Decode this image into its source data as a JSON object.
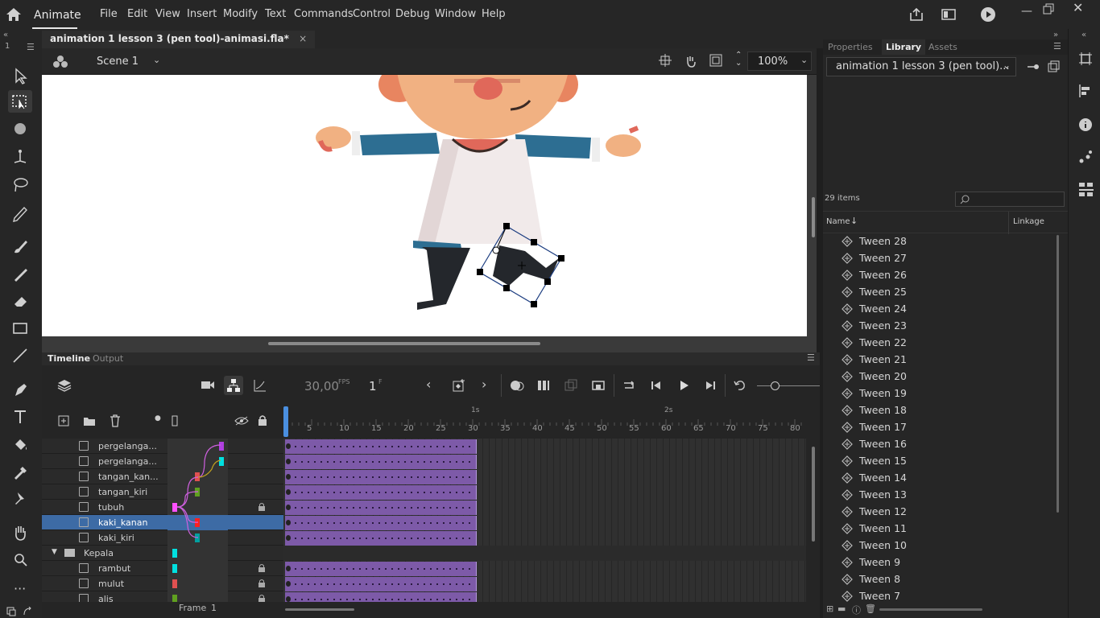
{
  "app": {
    "name": "Animate"
  },
  "menu": [
    "File",
    "Edit",
    "View",
    "Insert",
    "Modify",
    "Text",
    "Commands",
    "Control",
    "Debug",
    "Window",
    "Help"
  ],
  "document": {
    "tab_title": "animation 1 lesson 3 (pen tool)-animasi.fla*",
    "close": "×"
  },
  "toolbar_num": "1",
  "edit_bar": {
    "scene": "Scene 1",
    "zoom": "100%"
  },
  "panels": {
    "timeline_tab": "Timeline",
    "output_tab": "Output"
  },
  "timeline": {
    "fps": "30,00",
    "fps_unit": "FPS",
    "frame": "1",
    "frame_unit": "F",
    "second_marks": [
      "1s",
      "2s"
    ],
    "ruler": [
      "5",
      "10",
      "15",
      "20",
      "25",
      "30",
      "35",
      "40",
      "45",
      "50",
      "55",
      "60",
      "65",
      "70",
      "75",
      "80"
    ],
    "frame_label": "Frame",
    "frame_value": "1",
    "layers": [
      {
        "name": "pergelanga...",
        "color": "#b040e0",
        "lock": false,
        "tween": true
      },
      {
        "name": "pergelanga...",
        "color": "#00e0e0",
        "lock": false,
        "tween": true
      },
      {
        "name": "tangan_kan...",
        "color": "#e05050",
        "lock": false,
        "tween": true
      },
      {
        "name": "tangan_kiri",
        "color": "#60a020",
        "lock": false,
        "tween": true
      },
      {
        "name": "tubuh",
        "color": "#ff50ff",
        "lock": true,
        "tween": true
      },
      {
        "name": "kaki_kanan",
        "color": "#ff2020",
        "lock": false,
        "tween": true,
        "selected": true
      },
      {
        "name": "kaki_kiri",
        "color": "#00a0a0",
        "lock": false,
        "tween": true
      },
      {
        "name": "Kepala",
        "color": "#00e0e0",
        "lock": false,
        "tween": false,
        "folder": true
      },
      {
        "name": "rambut",
        "color": "#00e0e0",
        "lock": true,
        "tween": true
      },
      {
        "name": "mulut",
        "color": "#e05050",
        "lock": true,
        "tween": true
      },
      {
        "name": "alis",
        "color": "#60a020",
        "lock": true,
        "tween": true
      }
    ]
  },
  "right_panel": {
    "tabs": [
      "Properties",
      "Library",
      "Assets"
    ],
    "library_doc": "animation 1 lesson 3 (pen tool)...",
    "item_count": "29 items",
    "col_name": "Name",
    "col_linkage": "Linkage",
    "items": [
      "Tween 28",
      "Tween 27",
      "Tween 26",
      "Tween 25",
      "Tween 24",
      "Tween 23",
      "Tween 22",
      "Tween 21",
      "Tween 20",
      "Tween 19",
      "Tween 18",
      "Tween 17",
      "Tween 16",
      "Tween 15",
      "Tween 14",
      "Tween 13",
      "Tween 12",
      "Tween 11",
      "Tween 10",
      "Tween 9",
      "Tween 8",
      "Tween 7"
    ]
  },
  "colors": {
    "accent": "#3d6ba5",
    "tween": "#7d5aa8",
    "playhead": "#4a8fe0"
  }
}
